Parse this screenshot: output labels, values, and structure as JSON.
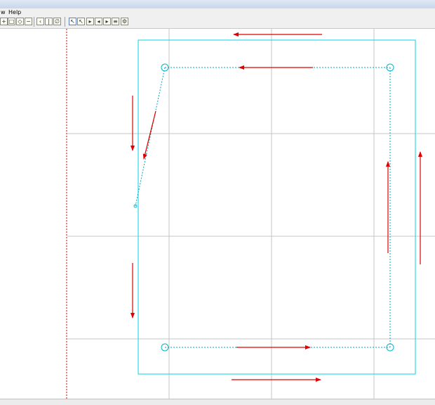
{
  "menu": {
    "view_fragment": "w",
    "help": "Help"
  },
  "toolbar": {
    "buttons": [
      {
        "icon": "zoom-in-icon"
      },
      {
        "icon": "zoom-window-icon"
      },
      {
        "icon": "zoom-extents-icon"
      },
      {
        "icon": "zoom-out-icon"
      },
      {
        "icon": "polyline-tool-icon"
      },
      {
        "icon": "line-tool-icon"
      },
      {
        "icon": "erase-tool-icon"
      },
      {
        "icon": "select-pointer-icon"
      },
      {
        "icon": "select-node-icon"
      },
      {
        "icon": "step-forward-icon"
      },
      {
        "icon": "step-start-icon"
      },
      {
        "icon": "step-end-icon"
      },
      {
        "icon": "step-align-icon"
      },
      {
        "icon": "step-all-icon"
      },
      {
        "icon": "toolpath-settings-icon"
      }
    ]
  },
  "colors": {
    "origin_line": "#e00000",
    "boundary": "#00d6e0",
    "path": "#00a8c0",
    "arrow": "#e00000",
    "grid": "#c4c4c4"
  }
}
